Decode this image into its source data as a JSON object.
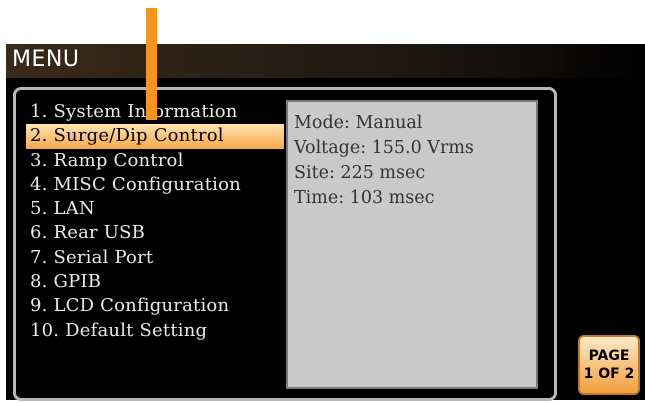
{
  "header": {
    "title": "MENU"
  },
  "menu": {
    "items": [
      {
        "label": "1. System Information",
        "selected": false
      },
      {
        "label": "2. Surge/Dip Control",
        "selected": true
      },
      {
        "label": "3. Ramp Control",
        "selected": false
      },
      {
        "label": "4. MISC Configuration",
        "selected": false
      },
      {
        "label": "5. LAN",
        "selected": false
      },
      {
        "label": "6. Rear USB",
        "selected": false
      },
      {
        "label": "7. Serial Port",
        "selected": false
      },
      {
        "label": "8. GPIB",
        "selected": false
      },
      {
        "label": "9. LCD Configuration",
        "selected": false
      },
      {
        "label": "10. Default Setting",
        "selected": false
      }
    ]
  },
  "info": {
    "lines": [
      "Mode: Manual",
      "Voltage: 155.0 Vrms",
      "Site: 225 msec",
      "Time: 103 msec"
    ]
  },
  "page_button": {
    "line1": "PAGE",
    "line2": "1 OF 2"
  },
  "colors": {
    "accent": "#f7941d",
    "highlight_top": "#fde3b4",
    "highlight_bottom": "#f7a84a",
    "info_bg": "#c9c9c9",
    "screen_bg": "#000000"
  },
  "icons": {
    "pointer": "orange-callout-arrow"
  }
}
